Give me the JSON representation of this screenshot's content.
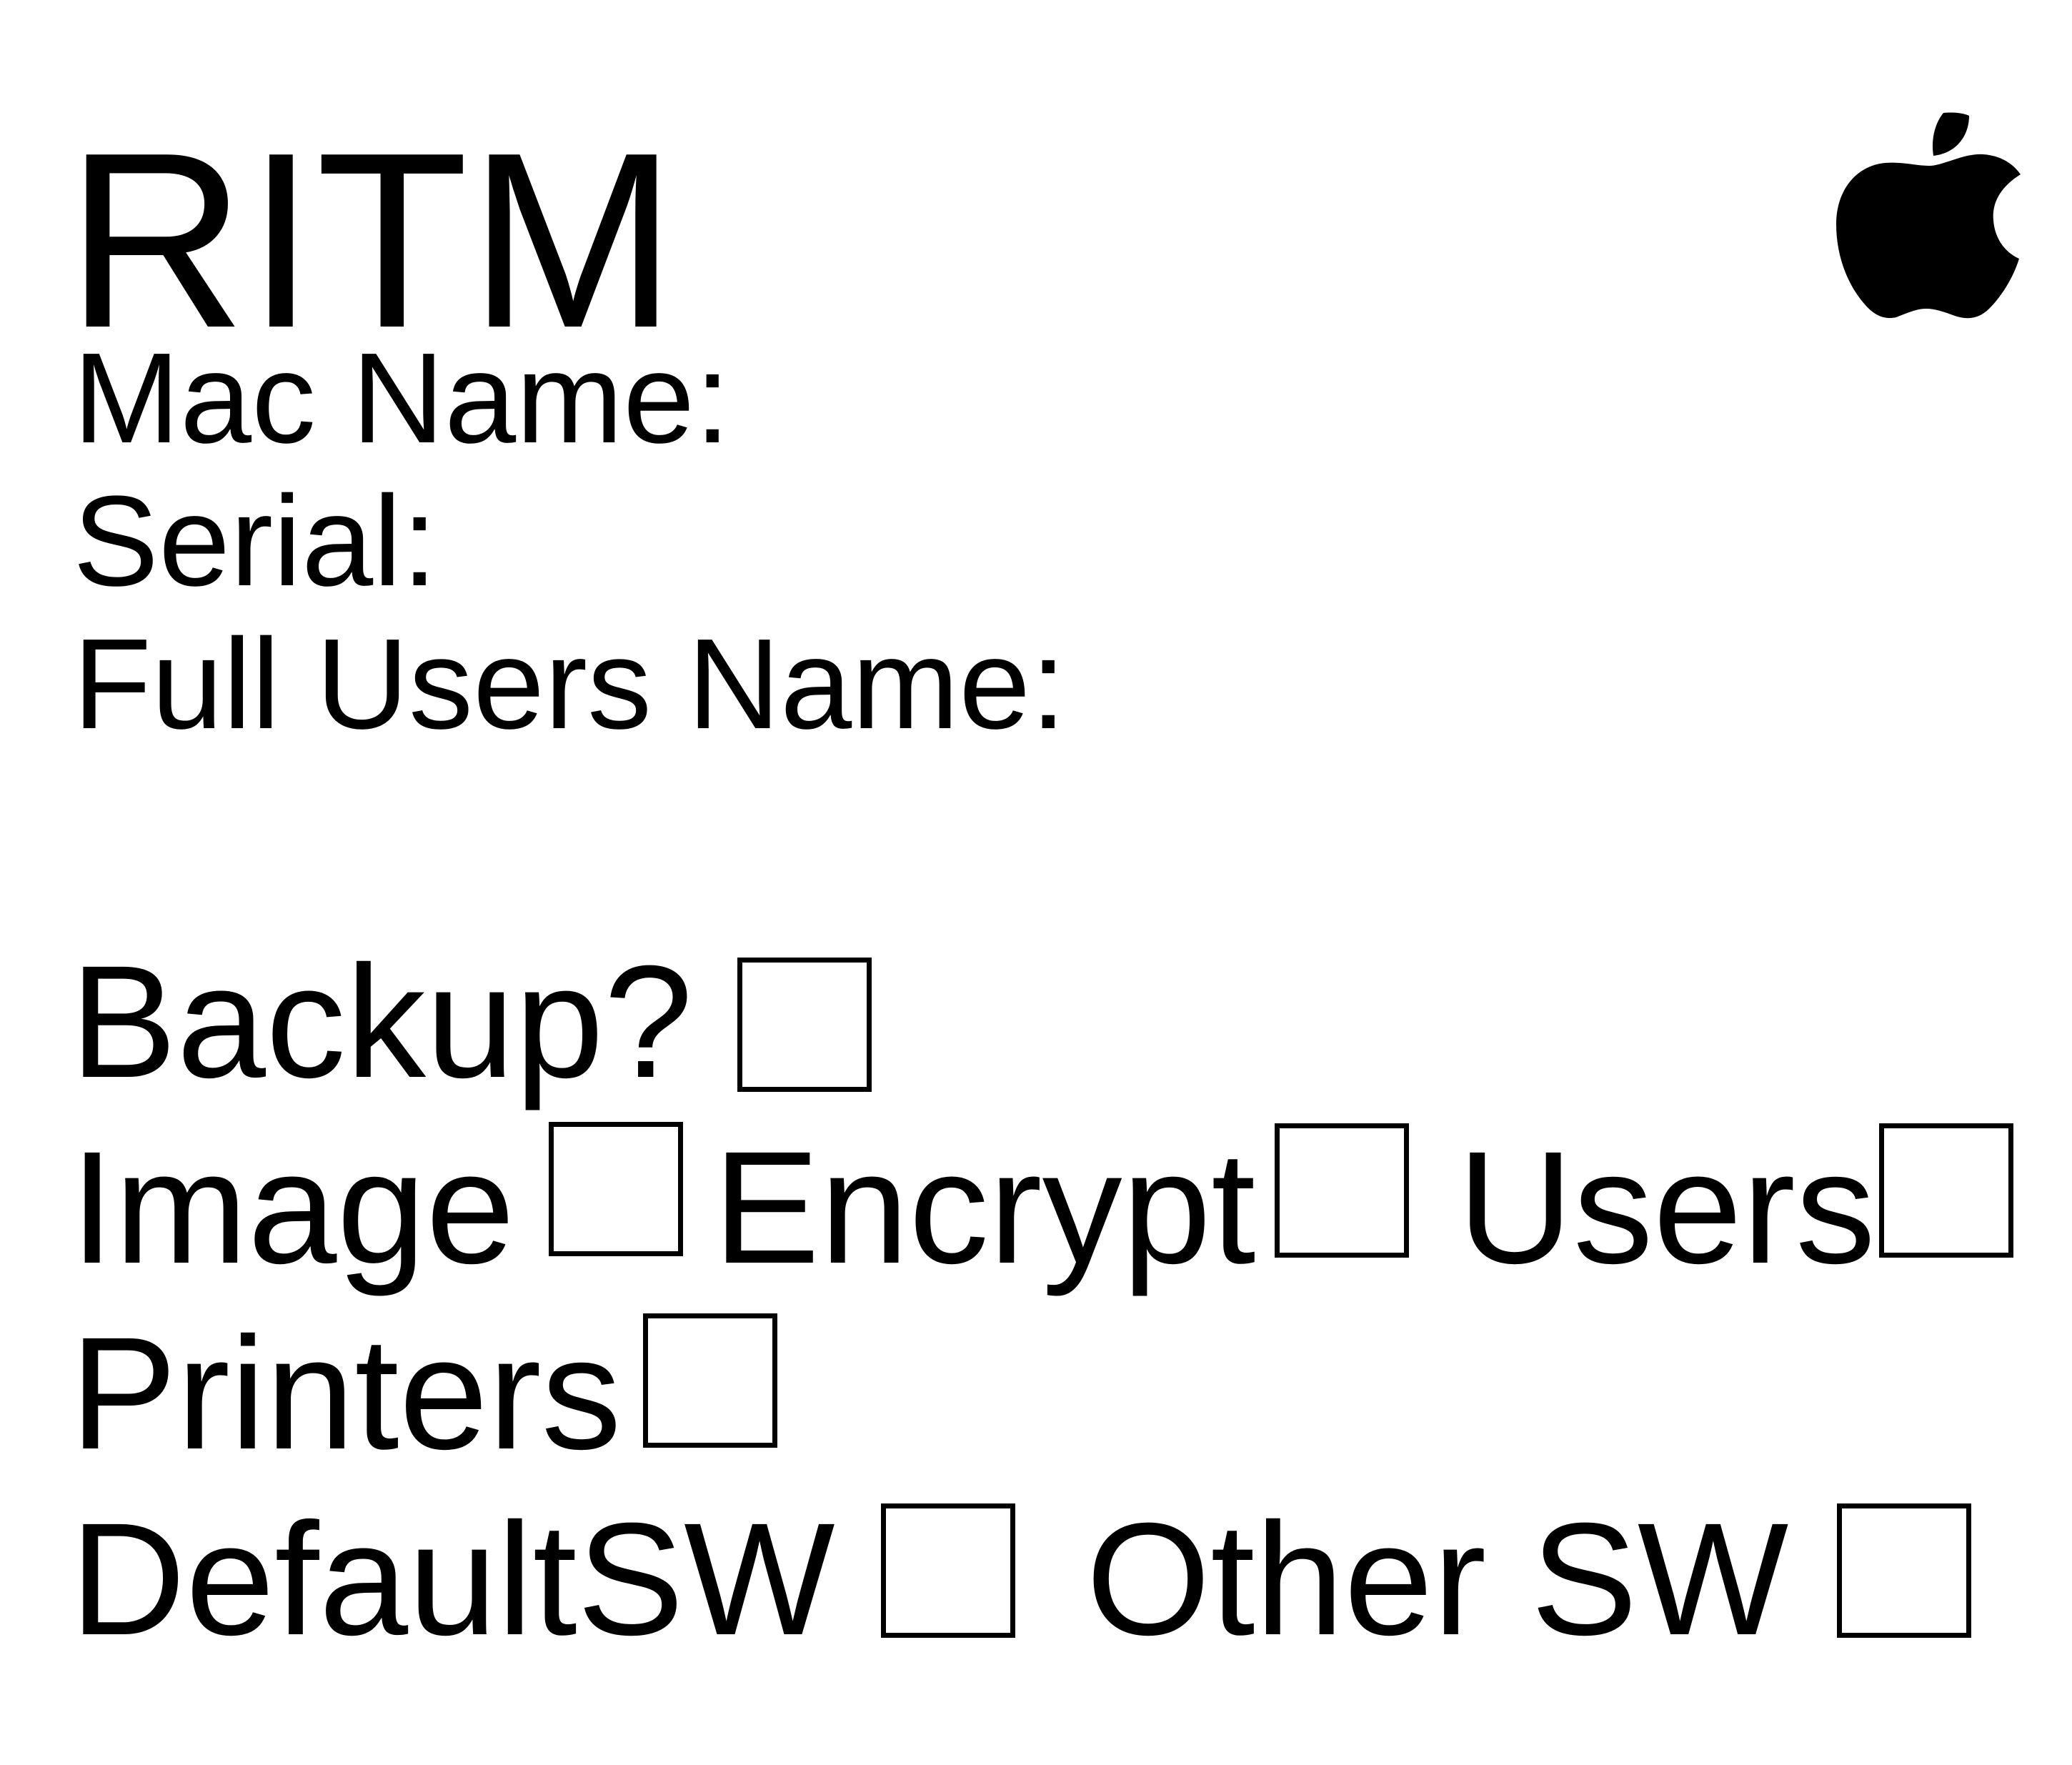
{
  "header": {
    "title": "RITM",
    "logo_icon": "apple-logo-icon"
  },
  "fields": {
    "mac_name": "Mac Name:",
    "serial": "Serial:",
    "full_users_name": "Full Users Name:"
  },
  "options": {
    "backup": "Backup?",
    "image": "Image",
    "encrypt": "Encrypt",
    "users": "Users",
    "printers": "Printers",
    "default_sw": "DefaultSW",
    "other_sw": "Other SW"
  },
  "colors": {
    "ink": "#000000",
    "paper": "#ffffff"
  }
}
